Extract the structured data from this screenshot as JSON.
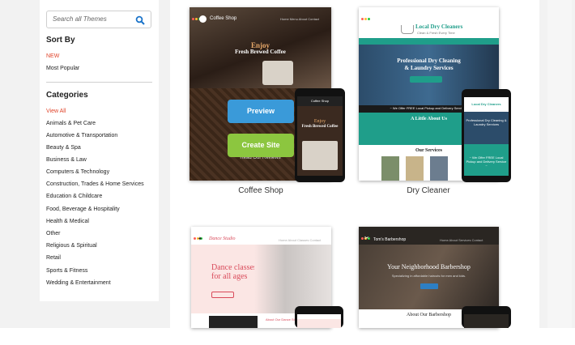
{
  "search": {
    "placeholder": "Search all Themes",
    "icon": "search-icon"
  },
  "sort": {
    "heading": "Sort By",
    "options": [
      "NEW",
      "Most Popular"
    ]
  },
  "categories": {
    "heading": "Categories",
    "items": [
      "View All",
      "Animals & Pet Care",
      "Automotive & Transportation",
      "Beauty & Spa",
      "Business & Law",
      "Computers & Technology",
      "Construction, Trades & Home Services",
      "Education & Childcare",
      "Food, Beverage & Hospitality",
      "Health & Medical",
      "Other",
      "Religious & Spiritual",
      "Retail",
      "Sports & Fitness",
      "Wedding & Entertainment"
    ]
  },
  "themes": [
    {
      "name": "Coffee Shop",
      "site_title": "Coffee Shop",
      "hero_line1": "Enjoy",
      "hero_line2": "Fresh Brewed Coffee",
      "preview_label": "Preview",
      "create_label": "Create Site",
      "reviews": "Read Our Reviews",
      "phone_title": "Coffee Shop",
      "phone_line1": "Enjoy",
      "phone_line2": "Fresh Brewed Coffee"
    },
    {
      "name": "Dry Cleaner",
      "site_title": "Local Dry Cleaners",
      "site_sub": "Clean & Fresh Every Time",
      "hero_line1": "Professional Dry Cleaning",
      "hero_line2": "& Laundry Services",
      "offer": "~ We Offer FREE Local Pickup and Delivery Service ~",
      "about": "A Little About Us",
      "services": "Our Services",
      "phone_title": "Local Dry Cleaners",
      "phone_hero": "Professional Dry Cleaning & Laundry Services",
      "phone_offer": "~ We Offer FREE Local Pickup and Delivery Service ~"
    },
    {
      "name": "Dance Studio",
      "site_title": "Dance Studio",
      "hero_line1": "Dance classes",
      "hero_line2": "for all ages",
      "about": "About Our Dance Studio"
    },
    {
      "name": "Barbershop",
      "site_title": "Tom's Barbershop",
      "hero_line1": "Your Neighborhood Barbershop",
      "hero_line2": "Specializing in affordable haircuts for men and kids.",
      "about": "About Our Barbershop"
    }
  ],
  "colors": {
    "accent_red": "#e0452b",
    "preview_blue": "#3a9ad9",
    "create_green": "#8cc63f",
    "dry_teal": "#1f9e8a"
  }
}
